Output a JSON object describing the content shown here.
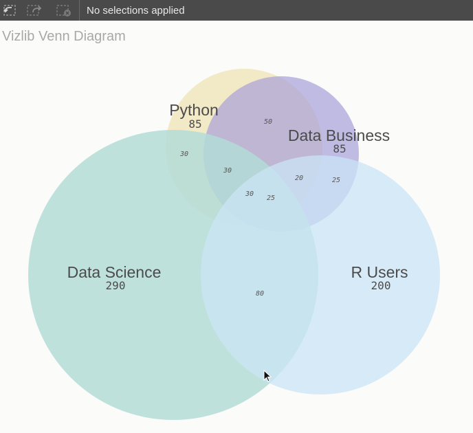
{
  "toolbar": {
    "status": "No selections applied",
    "icons": [
      "step-back-icon",
      "step-forward-icon",
      "clear-selections-icon"
    ]
  },
  "title": "Vizlib Venn Diagram",
  "chart_data": {
    "type": "venn",
    "sets": [
      {
        "name": "Python",
        "size": 85,
        "color": "#efe3b4"
      },
      {
        "name": "Data Business",
        "size": 85,
        "color": "#a9a2d8"
      },
      {
        "name": "Data Science",
        "size": 290,
        "color": "#b3dcd6"
      },
      {
        "name": "R Users",
        "size": 200,
        "color": "#cbe4f6"
      }
    ],
    "intersections": [
      {
        "sets": [
          "Python",
          "Data Business"
        ],
        "size": 50
      },
      {
        "sets": [
          "Python",
          "Data Science"
        ],
        "size": 30
      },
      {
        "sets": [
          "Python",
          "Data Business",
          "Data Science"
        ],
        "size": 30
      },
      {
        "sets": [
          "Data Business",
          "R Users"
        ],
        "size": 20
      },
      {
        "sets": [
          "Data Business",
          "R Users",
          "Python"
        ],
        "size": 25
      },
      {
        "sets": [
          "Python",
          "Data Business",
          "Data Science",
          "R Users"
        ],
        "size": 30
      },
      {
        "sets": [
          "Data Business",
          "Data Science",
          "R Users"
        ],
        "size": 25
      },
      {
        "sets": [
          "Data Science",
          "R Users"
        ],
        "size": 80
      }
    ]
  }
}
